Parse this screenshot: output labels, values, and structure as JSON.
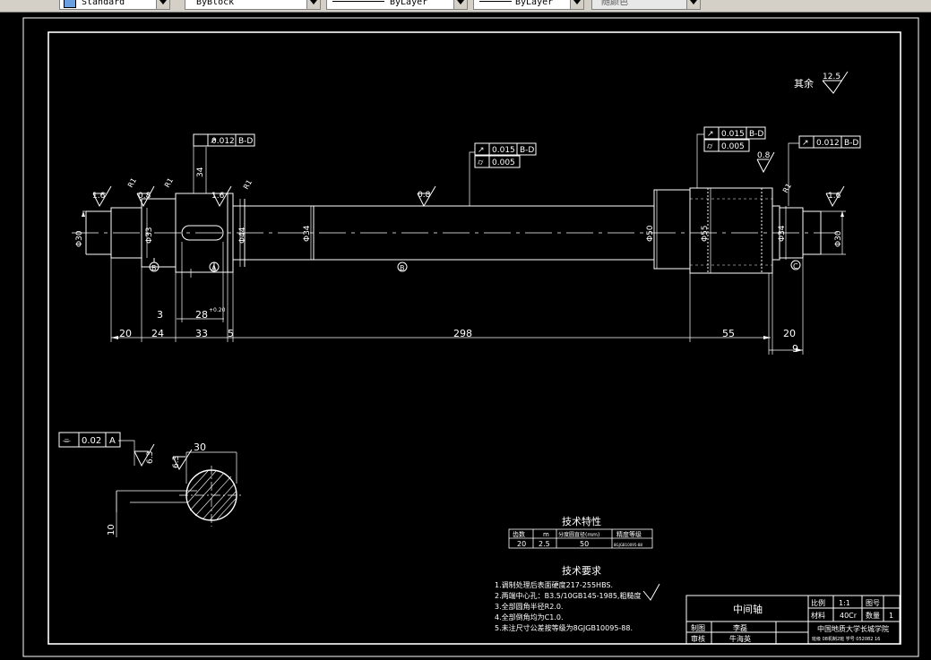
{
  "toolbar": {
    "style_combo": "Standard",
    "layer_combo": "ByBlock",
    "linetype_combo": "ByLayer",
    "lineweight_combo": "ByLayer",
    "color_combo": "随颜色"
  },
  "drawing": {
    "surface_rest": "其余",
    "surface_rest_value": "12.5",
    "roughness": {
      "r1": "1.6",
      "r2": "0.8",
      "r3": "1.6",
      "r4": "0.8",
      "r5": "0.8",
      "r6": "1.6",
      "r7": "6.3"
    },
    "tol_frames": {
      "f1_symbol": "↗",
      "f1_value": "0.012",
      "f1_datum": "B-D",
      "f2a_symbol": "↗",
      "f2a_value": "0.015",
      "f2a_datum": "B-D",
      "f2b_symbol": "⌭",
      "f2b_value": "0.005",
      "f3a_symbol": "↗",
      "f3a_value": "0.015",
      "f3a_datum": "B-D",
      "f3b_symbol": "⌭",
      "f3b_value": "0.005",
      "f4_symbol": "↗",
      "f4_value": "0.012",
      "f4_datum": "B-D",
      "f5_symbol": "⌯",
      "f5_value": "0.02",
      "f5_datum": "A"
    },
    "diameters": {
      "d1": "Φ30",
      "d2": "Φ33",
      "d3": "Φ44",
      "d4": "Φ34",
      "d5": "Φ50",
      "d6": "Φ55",
      "d7": "Φ34",
      "d8": "Φ30",
      "key_depth": "34"
    },
    "datums": {
      "b": "B",
      "a": "A",
      "bb": "B",
      "c": "C"
    },
    "chamfers": {
      "c1": "R1",
      "c2": "R1",
      "c3": "R1",
      "c4": "R1",
      "c5": "R1"
    },
    "lengths": {
      "l1": "20",
      "l2": "24",
      "l3": "33",
      "l4": "5",
      "l5": "298",
      "l6": "55",
      "l7": "20",
      "l8": "9",
      "l9": "3",
      "l10": "28"
    },
    "tol_sup": "+0.20",
    "section": {
      "width": "30",
      "depth": "10",
      "sym_label": "6.3"
    },
    "tech_char": {
      "title": "技术特性",
      "headers": [
        "齿数",
        "m",
        "分度圆直径(mm)",
        "精度等级"
      ],
      "row": [
        "20",
        "2.5",
        "50",
        "8GJGB10095-88"
      ]
    },
    "tech_req": {
      "title": "技术要求",
      "items": [
        "1.调制处理后表面硬度217-255HBS.",
        "2.两端中心孔：B3.5/10GB145-1985,粗糙度",
        "3.全部圆角半径R2.0.",
        "4.全部倒角均为C1.0.",
        "5.未注尺寸公差按等级为8GJGB10095-88."
      ]
    },
    "title_block": {
      "part_name": "中间轴",
      "scale_label": "比例",
      "scale_value": "1:1",
      "drawing_no_label": "图号",
      "material_label": "材料",
      "material_value": "40Cr",
      "qty_label": "数量",
      "qty_value": "1",
      "drawn_label": "制图",
      "drawn_value": "李磊",
      "check_label": "审核",
      "check_value": "牛海英",
      "school": "中国地质大学长城学院",
      "class_info": "班级 08机制2班   学号 052082 16"
    }
  }
}
